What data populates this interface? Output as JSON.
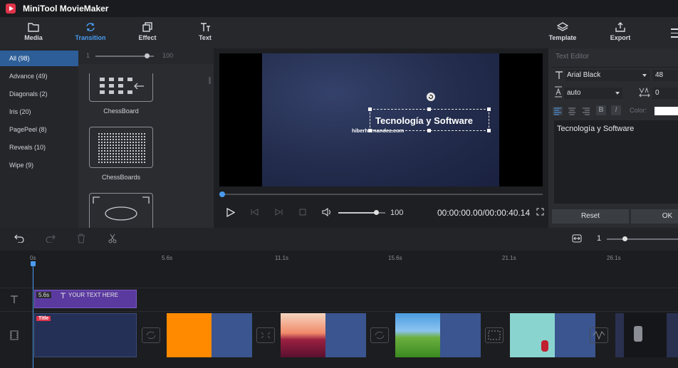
{
  "app": {
    "title": "MiniTool MovieMaker"
  },
  "toolbar": {
    "media": "Media",
    "transition": "Transition",
    "effect": "Effect",
    "text": "Text",
    "template": "Template",
    "export": "Export"
  },
  "categories": [
    {
      "label": "All",
      "count": "(98)"
    },
    {
      "label": "Advance",
      "count": "(49)"
    },
    {
      "label": "Diagonals",
      "count": "(2)"
    },
    {
      "label": "Iris",
      "count": "(20)"
    },
    {
      "label": "PagePeel",
      "count": "(8)"
    },
    {
      "label": "Reveals",
      "count": "(10)"
    },
    {
      "label": "Wipe",
      "count": "(9)"
    }
  ],
  "gallery": {
    "slider_min": "1",
    "slider_max": "100",
    "slider_fraction": 0.88,
    "items": [
      "ChessBoard",
      "ChessBoards"
    ]
  },
  "preview": {
    "overlay_title": "Tecnología y Software",
    "overlay_subtitle": "hiberhernandez.com",
    "volume": "100",
    "volume_fraction": 0.8,
    "time": "00:00:00.00/00:00:40.14"
  },
  "text_editor": {
    "header": "Text Editor",
    "font": "Arial Black",
    "size": "48",
    "line_spacing": "auto",
    "char_spacing": "0",
    "color_label": "Color:",
    "content": "Tecnología y Software",
    "reset": "Reset",
    "ok": "OK"
  },
  "timeline": {
    "zoom": "1",
    "ruler": [
      "0s",
      "5.6s",
      "11.1s",
      "15.6s",
      "21.1s",
      "26.1s"
    ],
    "text_clip": {
      "duration": "5.6s",
      "label": "YOUR TEXT HERE"
    },
    "title_badge": "Title"
  },
  "colors": {
    "accent": "#4a9bf0",
    "selected": "#2d5e98",
    "text_clip": "#5b3aa0"
  }
}
